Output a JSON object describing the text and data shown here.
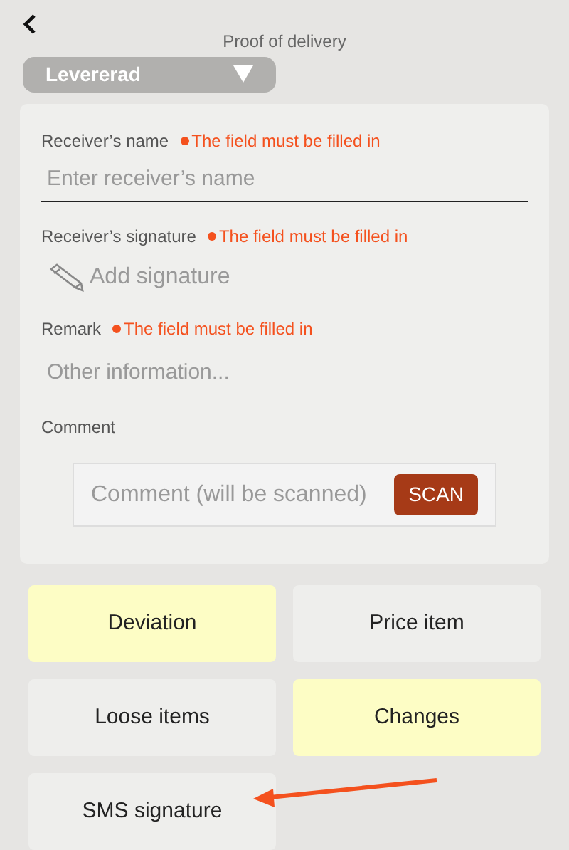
{
  "header": {
    "title": "Proof of delivery"
  },
  "status_dropdown": {
    "value": "Levererad"
  },
  "fields": [
    {
      "kind": "text",
      "label": "Receiver’s name",
      "error": "The field must be filled in",
      "placeholder": "Enter receiver’s name"
    },
    {
      "kind": "signature",
      "label": "Receiver’s signature",
      "error": "The field must be filled in",
      "action": "Add signature"
    },
    {
      "kind": "plain",
      "label": "Remark",
      "error": "The field must be filled in",
      "placeholder": "Other information..."
    },
    {
      "kind": "scan",
      "label": "Comment",
      "placeholder": "Comment (will be scanned)",
      "button": "SCAN"
    }
  ],
  "buttons": [
    {
      "label": "Deviation",
      "highlighted": true
    },
    {
      "label": "Price item",
      "highlighted": false
    },
    {
      "label": "Loose items",
      "highlighted": false
    },
    {
      "label": "Changes",
      "highlighted": true
    },
    {
      "label": "SMS signature",
      "highlighted": false
    }
  ]
}
